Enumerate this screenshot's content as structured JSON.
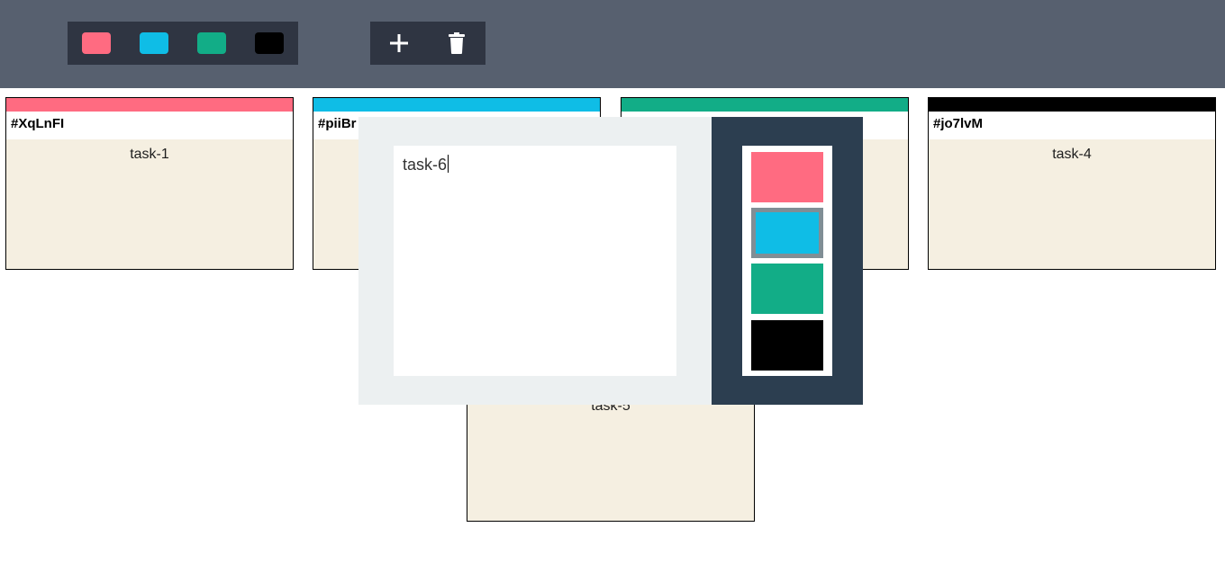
{
  "colors": {
    "pink": "#ff6b81",
    "blue": "#0fbde6",
    "green": "#12ad87",
    "black": "#000000"
  },
  "toolbar": {
    "filters": [
      {
        "name": "pink",
        "color": "#ff6b81"
      },
      {
        "name": "blue",
        "color": "#0fbde6"
      },
      {
        "name": "green",
        "color": "#12ad87"
      },
      {
        "name": "black",
        "color": "#000000"
      }
    ],
    "actions": [
      {
        "icon": "plus-icon"
      },
      {
        "icon": "trash-icon"
      }
    ]
  },
  "tickets": [
    {
      "id": "#XqLnFI",
      "task": "task-1",
      "color": "#ff6b81"
    },
    {
      "id": "#piiBr",
      "task": "",
      "color": "#0fbde6"
    },
    {
      "id": "",
      "task": "",
      "color": "#12ad87"
    },
    {
      "id": "#jo7lvM",
      "task": "task-4",
      "color": "#000000"
    },
    {
      "id": "",
      "task": "task-5",
      "color": ""
    }
  ],
  "modal": {
    "text": "task-6",
    "priority_colors": [
      "#ff6b81",
      "#0fbde6",
      "#12ad87",
      "#000000"
    ],
    "selected_priority": "#0fbde6"
  }
}
